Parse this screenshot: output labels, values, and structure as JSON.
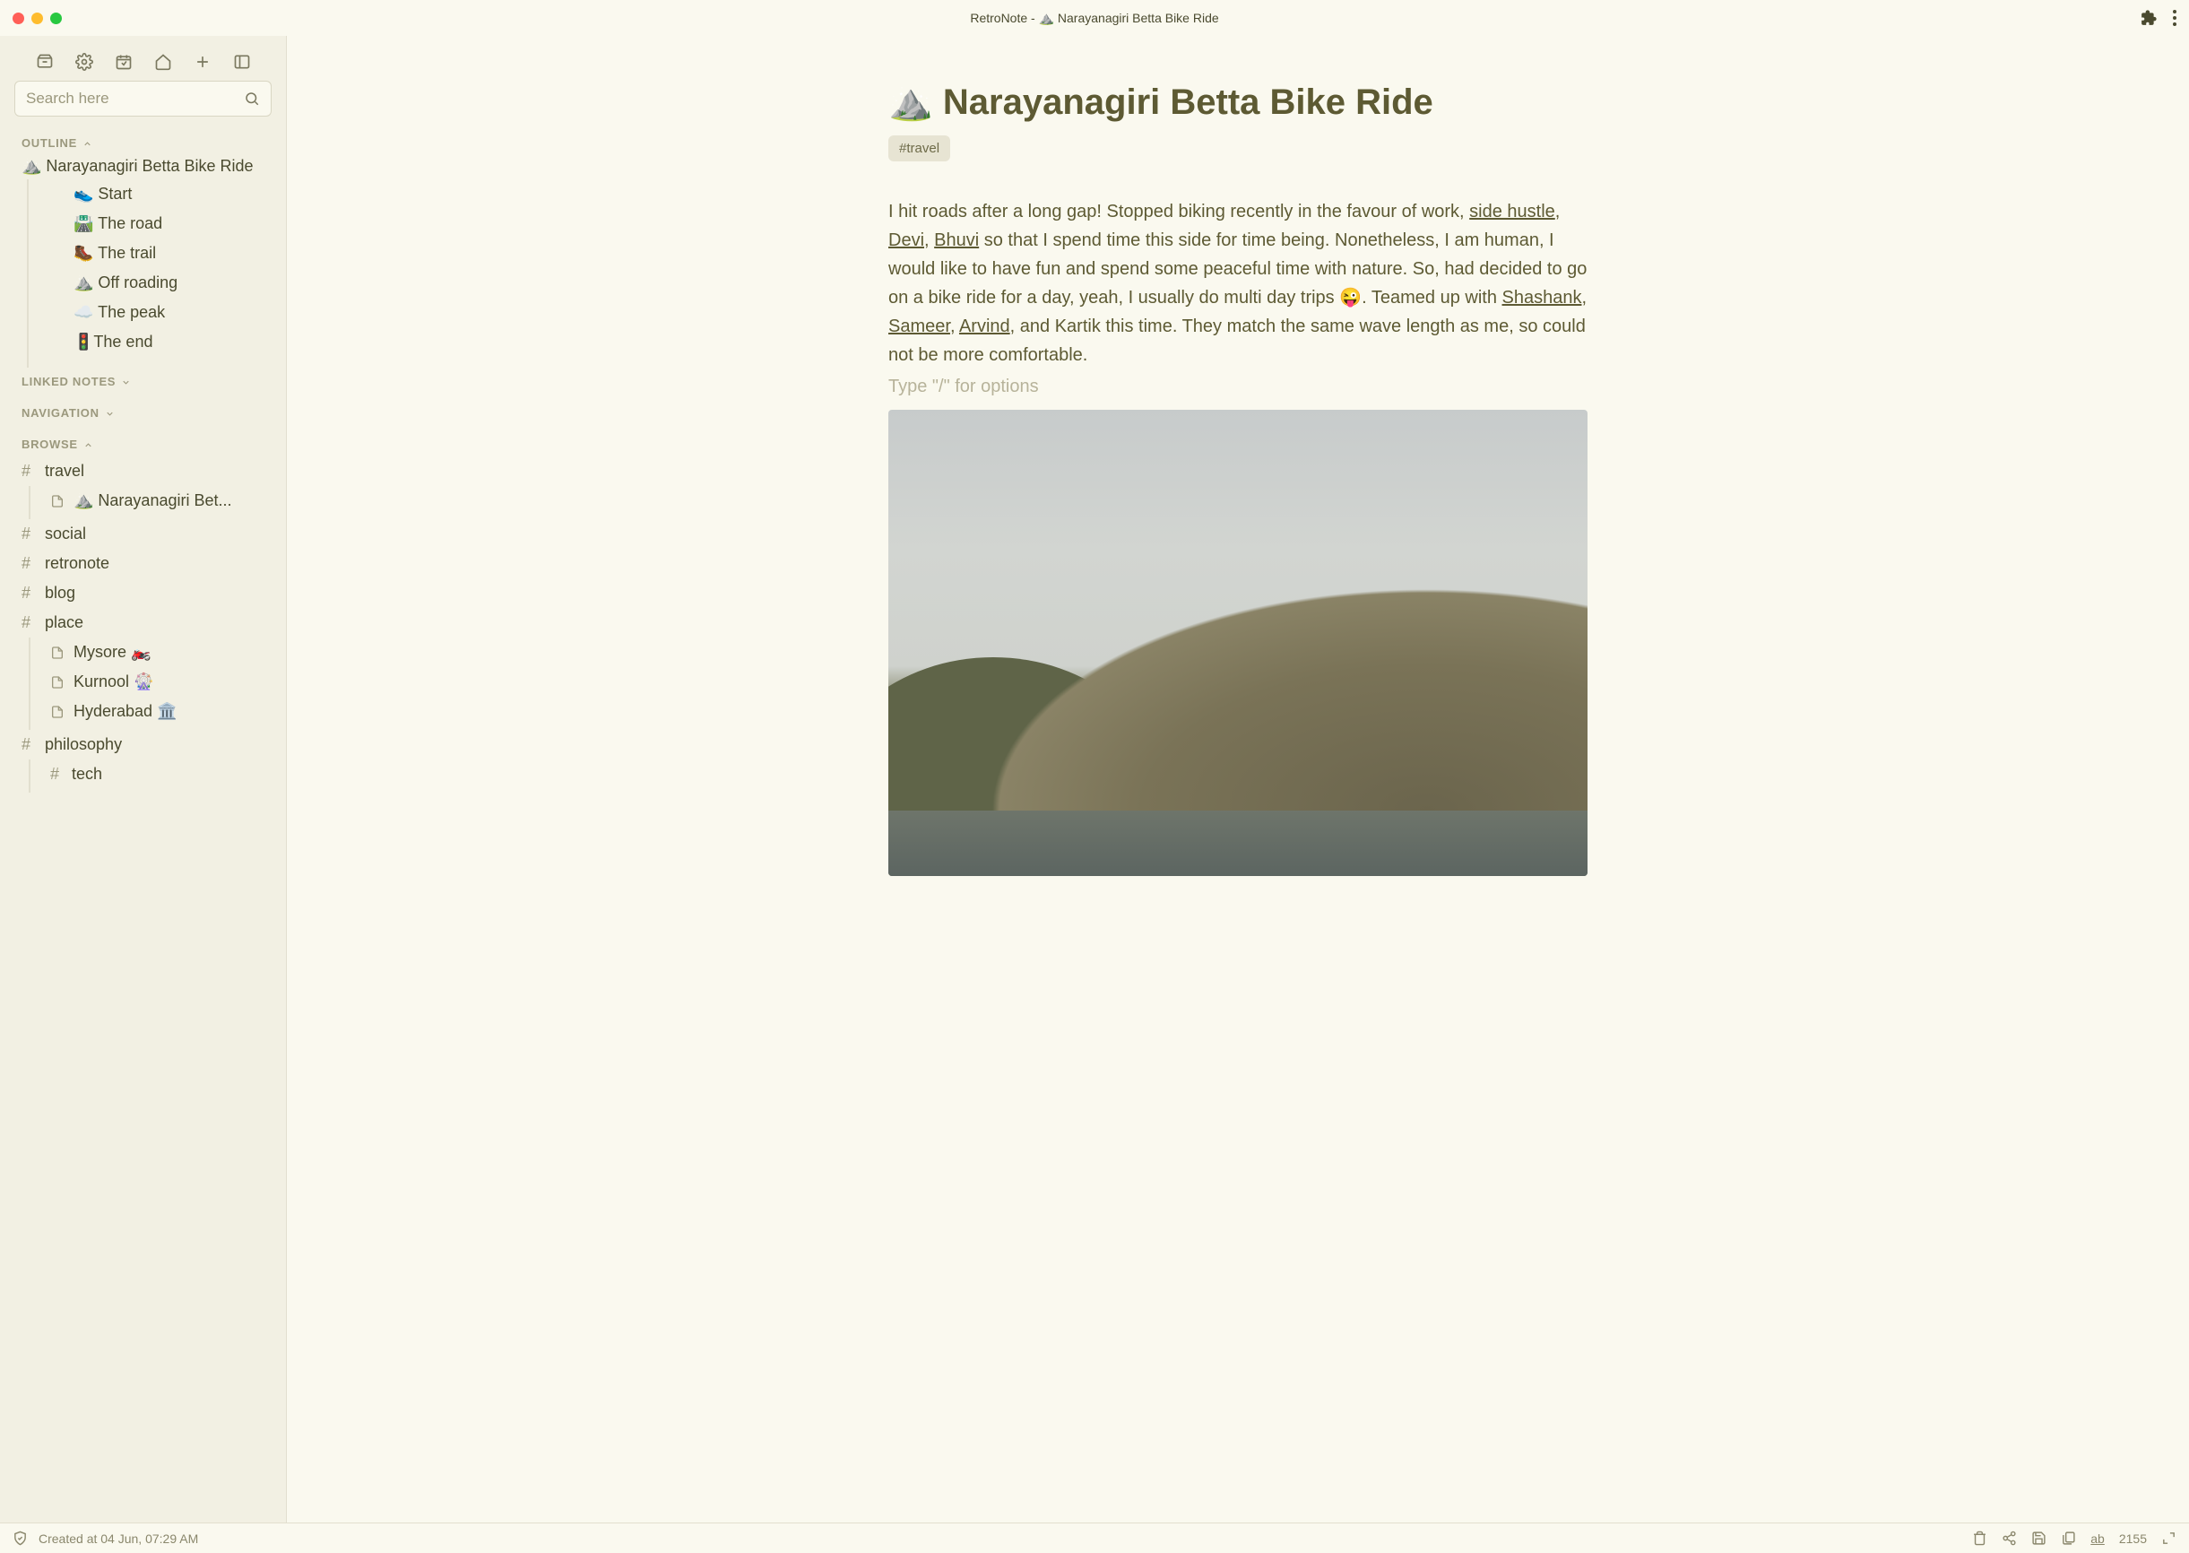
{
  "app": {
    "window_title": "RetroNote - ⛰️ Narayanagiri Betta Bike Ride"
  },
  "search": {
    "placeholder": "Search here"
  },
  "sections": {
    "outline": "OUTLINE",
    "linked_notes": "LINKED NOTES",
    "navigation": "NAVIGATION",
    "browse": "BROWSE"
  },
  "outline": {
    "root": "⛰️ Narayanagiri Betta Bike Ride",
    "items": [
      "👟 Start",
      "🛣️ The road",
      "🥾 The trail",
      "⛰️ Off roading",
      "☁️ The peak",
      "🚦The end"
    ]
  },
  "browse": {
    "tags": [
      {
        "name": "travel",
        "pages": [
          "⛰️ Narayanagiri Bet..."
        ]
      },
      {
        "name": "social",
        "pages": []
      },
      {
        "name": "retronote",
        "pages": []
      },
      {
        "name": "blog",
        "pages": []
      },
      {
        "name": "place",
        "pages": [
          "Mysore 🏍️",
          "Kurnool 🎡",
          "Hyderabad 🏛️"
        ]
      },
      {
        "name": "philosophy",
        "subtags": [
          "tech"
        ]
      }
    ]
  },
  "doc": {
    "title": "⛰️ Narayanagiri Betta Bike Ride",
    "tag_pill": "#travel",
    "para": {
      "seg1": "I hit roads after a long gap! Stopped biking recently in the favour of work, ",
      "link_sidehustle": "side hustle",
      "sep1": ", ",
      "link_devi": "Devi",
      "sep2": ", ",
      "link_bhuvi": "Bhuvi",
      "seg2": " so that I spend time this side for time being. Nonetheless, I am human, I would like to have fun and spend some peaceful time with nature. So, had decided to go on a bike ride for a day, yeah, I usually do multi day trips 😜. Teamed up with ",
      "link_shashank": "Shashank",
      "sep3": ", ",
      "link_sameer": "Sameer",
      "sep4": ", ",
      "link_arvind": "Arvind",
      "seg3": ", and Kartik this time. They match the same wave length as me, so could not be more comfortable."
    },
    "placeholder": "Type \"/\" for options"
  },
  "status": {
    "created": "Created at 04 Jun, 07:29 AM",
    "word_count": "2155"
  },
  "icons": {
    "shield": "shield-icon",
    "delete": "trash-icon",
    "share": "share-icon",
    "save": "save-icon",
    "copy": "files-icon",
    "ab": "ab",
    "expand": "expand-icon"
  }
}
